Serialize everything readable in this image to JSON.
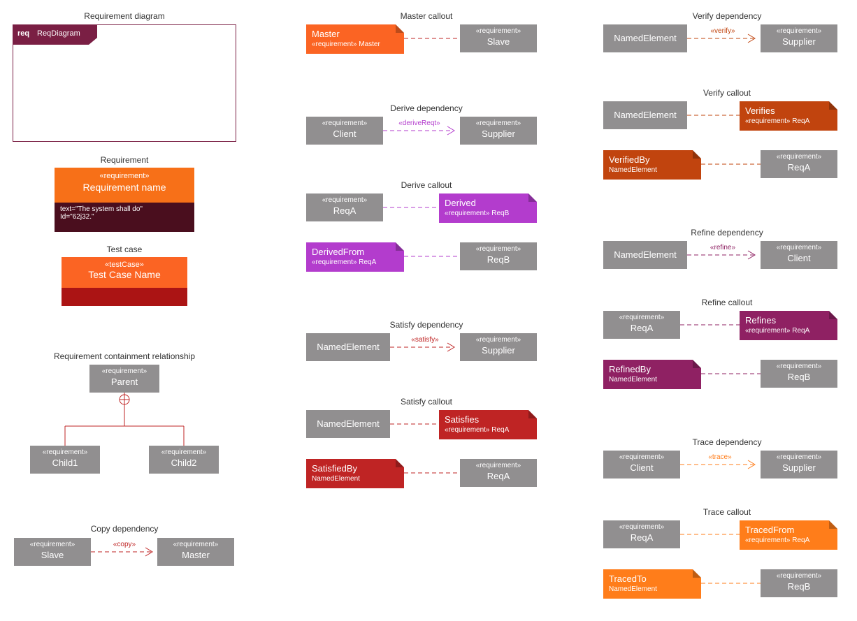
{
  "col1": {
    "reqDiagram": {
      "label": "Requirement diagram",
      "req": "req",
      "name": "ReqDiagram"
    },
    "requirement": {
      "label": "Requirement",
      "stereo": "«requirement»",
      "name": "Requirement name",
      "text": "text=\"The system shall do\"",
      "id": "Id=\"62j32.\""
    },
    "testCase": {
      "label": "Test case",
      "stereo": "«testCase»",
      "name": "Test Case Name"
    },
    "containment": {
      "label": "Requirement containment relationship",
      "parentStereo": "«requirement»",
      "parent": "Parent",
      "c1Stereo": "«requirement»",
      "c1": "Child1",
      "c2Stereo": "«requirement»",
      "c2": "Child2"
    },
    "copy": {
      "label": "Copy dependency",
      "slaveStereo": "«requirement»",
      "slave": "Slave",
      "dep": "«copy»",
      "masterStereo": "«requirement»",
      "master": "Master"
    }
  },
  "col2": {
    "master": {
      "label": "Master callout",
      "callout": "Master",
      "calloutSub": "«requirement» Master",
      "slaveStereo": "«requirement»",
      "slave": "Slave"
    },
    "deriveDep": {
      "label": "Derive dependency",
      "clientStereo": "«requirement»",
      "client": "Client",
      "dep": "«deriveReqt»",
      "supStereo": "«requirement»",
      "sup": "Supplier"
    },
    "deriveCall": {
      "label": "Derive callout",
      "aStereo": "«requirement»",
      "a": "ReqA",
      "derived": "Derived",
      "derivedSub": "«requirement» ReqB",
      "derivedFrom": "DerivedFrom",
      "derivedFromSub": "«requirement» ReqA",
      "bStereo": "«requirement»",
      "b": "ReqB"
    },
    "satisfyDep": {
      "label": "Satisfy dependency",
      "ne": "NamedElement",
      "dep": "«satisfy»",
      "supStereo": "«requirement»",
      "sup": "Supplier"
    },
    "satisfyCall": {
      "label": "Satisfy callout",
      "ne": "NamedElement",
      "sat": "Satisfies",
      "satSub": "«requirement» ReqA",
      "satBy": "SatisfiedBy",
      "satBySub": "NamedElement",
      "aStereo": "«requirement»",
      "a": "ReqA"
    }
  },
  "col3": {
    "verifyDep": {
      "label": "Verify dependency",
      "ne": "NamedElement",
      "dep": "«verify»",
      "supStereo": "«requirement»",
      "sup": "Supplier"
    },
    "verifyCall": {
      "label": "Verify callout",
      "ne": "NamedElement",
      "ver": "Verifies",
      "verSub": "«requirement» ReqA",
      "verBy": "VerifiedBy",
      "verBySub": "NamedElement",
      "aStereo": "«requirement»",
      "a": "ReqA"
    },
    "refineDep": {
      "label": "Refine dependency",
      "ne": "NamedElement",
      "dep": "«refine»",
      "clStereo": "«requirement»",
      "cl": "Client"
    },
    "refineCall": {
      "label": "Refine callout",
      "aStereo": "«requirement»",
      "a": "ReqA",
      "ref": "Refines",
      "refSub": "«requirement» ReqA",
      "refBy": "RefinedBy",
      "refBySub": "NamedElement",
      "bStereo": "«requirement»",
      "b": "ReqB"
    },
    "traceDep": {
      "label": "Trace dependency",
      "clStereo": "«requirement»",
      "cl": "Client",
      "dep": "«trace»",
      "supStereo": "«requirement»",
      "sup": "Supplier"
    },
    "traceCall": {
      "label": "Trace callout",
      "aStereo": "«requirement»",
      "a": "ReqA",
      "tf": "TracedFrom",
      "tfSub": "«requirement» ReqA",
      "tt": "TracedTo",
      "ttSub": "NamedElement",
      "bStereo": "«requirement»",
      "b": "ReqB"
    }
  },
  "colors": {
    "gray": "#918f90",
    "orange": "#f77018",
    "orangeL": "#fb6423",
    "darkRed": "#ab1414",
    "red": "#bf2424",
    "purple": "#b33ccd",
    "magenta": "#8f2163",
    "rust": "#c1440e",
    "tangerine": "#ff7d1a",
    "maroon": "#7a1f44"
  }
}
